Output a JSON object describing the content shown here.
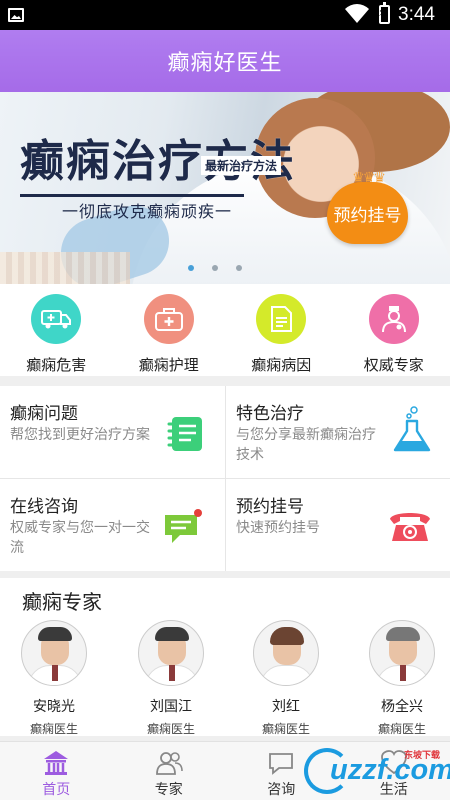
{
  "status_bar": {
    "time": "3:44"
  },
  "app": {
    "title": "癫痫好医生"
  },
  "banner": {
    "headline": "癫痫治疗方法",
    "tag": "最新治疗方法",
    "subtitle": "一彻底攻克癫痫顽疾一",
    "button": "预约挂号",
    "slide_count": 3,
    "active_slide": 1
  },
  "quick_menu": [
    {
      "label": "癫痫危害",
      "icon": "ambulance-icon",
      "color": "#3fd6c8"
    },
    {
      "label": "癫痫护理",
      "icon": "first-aid-kit-icon",
      "color": "#f0907f"
    },
    {
      "label": "癫痫病因",
      "icon": "document-icon",
      "color": "#d4ea2a"
    },
    {
      "label": "权威专家",
      "icon": "doctor-icon",
      "color": "#ef6fa8"
    }
  ],
  "features": [
    {
      "title": "癫痫问题",
      "desc": "帮您找到更好治疗方案",
      "icon": "notebook-icon"
    },
    {
      "title": "特色治疗",
      "desc": "与您分享最新癫痫治疗技术",
      "icon": "flask-icon"
    },
    {
      "title": "在线咨询",
      "desc": "权威专家与您一对一交流",
      "icon": "chat-icon"
    },
    {
      "title": "预约挂号",
      "desc": "快速预约挂号",
      "icon": "telephone-icon"
    }
  ],
  "experts": {
    "section_title": "癫痫专家",
    "doctors": [
      {
        "name": "安晓光",
        "role": "癫痫医生"
      },
      {
        "name": "刘国江",
        "role": "癫痫医生"
      },
      {
        "name": "刘红",
        "role": "癫痫医生"
      },
      {
        "name": "杨全兴",
        "role": "癫痫医生"
      }
    ]
  },
  "tabs": [
    {
      "label": "首页",
      "icon": "home-icon",
      "active": true
    },
    {
      "label": "专家",
      "icon": "experts-icon",
      "active": false
    },
    {
      "label": "咨询",
      "icon": "consult-icon",
      "active": false
    },
    {
      "label": "生活",
      "icon": "life-icon",
      "active": false
    }
  ],
  "watermark": {
    "text": "uzzf.com",
    "caption": "东坡下载"
  }
}
